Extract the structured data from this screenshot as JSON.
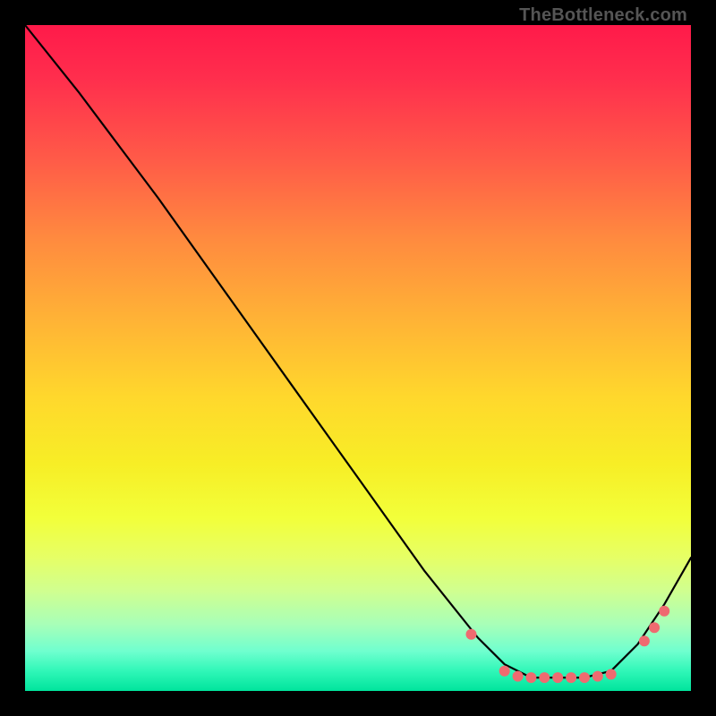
{
  "watermark": "TheBottleneck.com",
  "chart_data": {
    "type": "line",
    "title": "",
    "xlabel": "",
    "ylabel": "",
    "xlim": [
      0,
      100
    ],
    "ylim": [
      0,
      100
    ],
    "series": [
      {
        "name": "curve",
        "x": [
          0,
          8,
          20,
          30,
          40,
          50,
          60,
          68,
          72,
          76,
          80,
          84,
          88,
          92,
          96,
          100
        ],
        "y": [
          100,
          90,
          74,
          60,
          46,
          32,
          18,
          8,
          4,
          2,
          2,
          2,
          3,
          7,
          13,
          20
        ]
      }
    ],
    "markers": {
      "name": "dots",
      "x": [
        67,
        72,
        74,
        76,
        78,
        80,
        82,
        84,
        86,
        88,
        93,
        94.5,
        96
      ],
      "y": [
        8.5,
        3.0,
        2.2,
        2.0,
        2.0,
        2.0,
        2.0,
        2.0,
        2.2,
        2.5,
        7.5,
        9.5,
        12.0
      ],
      "color": "#ef6a70",
      "radius": 6
    }
  }
}
